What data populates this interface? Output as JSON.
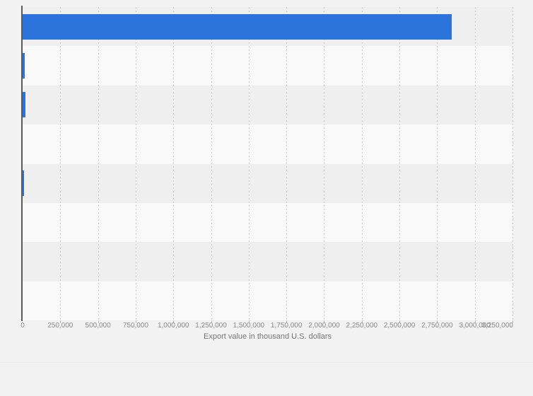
{
  "chart_data": {
    "type": "bar",
    "orientation": "horizontal",
    "title": "",
    "xlabel": "Export value in thousand U.S. dollars",
    "ylabel": "",
    "xlim": [
      0,
      3250000
    ],
    "xtick_interval": 250000,
    "xtick_labels": [
      "0",
      "250,000",
      "500,000",
      "750,000",
      "1,000,000",
      "1,250,000",
      "1,500,000",
      "1,750,000",
      "2,000,000",
      "2,250,000",
      "2,500,000",
      "2,750,000",
      "3,000,000",
      "3,250,000"
    ],
    "categories": [
      "",
      "",
      "",
      "",
      "",
      "",
      "",
      ""
    ],
    "values": [
      2845000,
      13000,
      21000,
      0,
      8000,
      0,
      0,
      0
    ],
    "grid": "vertical-dotted",
    "legend_position": "none"
  },
  "colors": {
    "bar": "#2d73dc",
    "background": "#f2f2f2",
    "stripe_dark": "#efefef",
    "stripe_light": "#f9f9f9",
    "axis_line": "#5a5a5c",
    "gridline": "#c9c9c9",
    "tick_label": "#8c8c8c",
    "axis_title": "#767676"
  }
}
